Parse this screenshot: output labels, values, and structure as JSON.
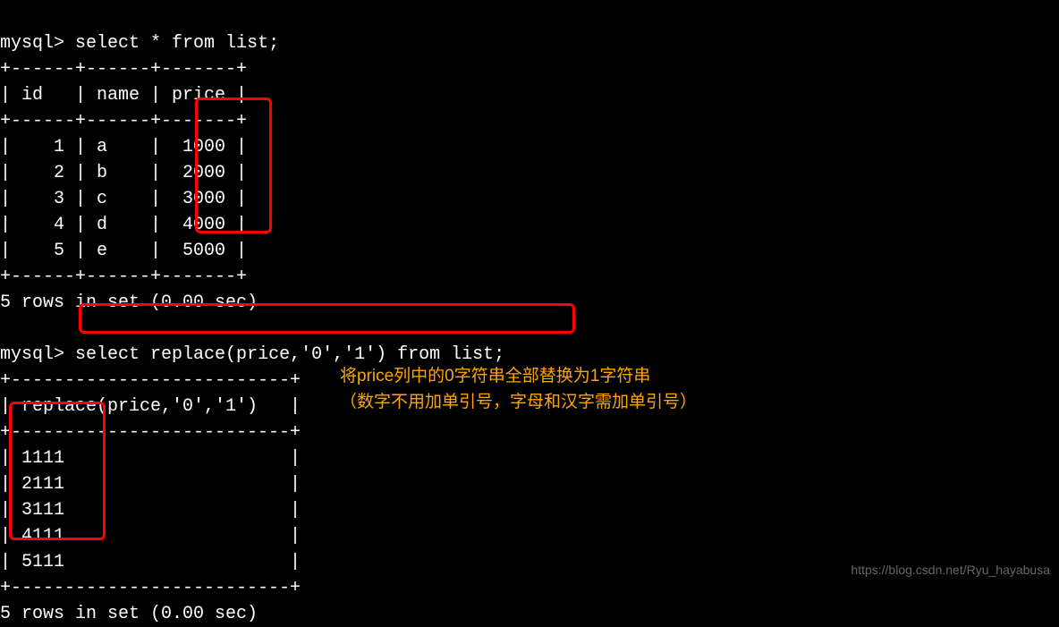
{
  "terminal": {
    "prompt": "mysql>",
    "query1": "select * from list;",
    "table1": {
      "border_top": "+------+------+-------+",
      "header": "| id   | name | price |",
      "rows": [
        "|    1 | a    |  1000 |",
        "|    2 | b    |  2000 |",
        "|    3 | c    |  3000 |",
        "|    4 | d    |  4000 |",
        "|    5 | e    |  5000 |"
      ]
    },
    "result1": "5 rows in set (0.00 sec)",
    "query2": "select replace(price,'0','1') from list;",
    "table2": {
      "border_top": "+--------------------------+",
      "header": "| replace(price,'0','1')   |",
      "rows": [
        "| 1111                     |",
        "| 2111                     |",
        "| 3111                     |",
        "| 4111                     |",
        "| 5111                     |"
      ]
    },
    "result2": "5 rows in set (0.00 sec)"
  },
  "annotation": {
    "line1": "将price列中的0字符串全部替换为1字符串",
    "line2": "（数字不用加单引号，字母和汉字需加单引号）"
  },
  "watermark": "https://blog.csdn.net/Ryu_hayabusa"
}
